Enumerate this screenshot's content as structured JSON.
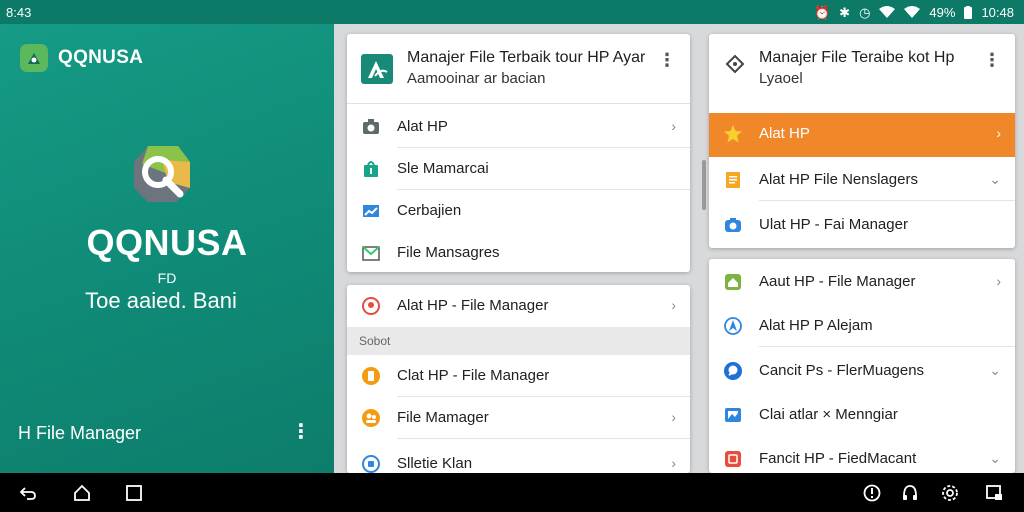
{
  "status_bar": {
    "left_text": "8:43",
    "right_text": "49%",
    "time": "10:48",
    "icons": [
      "alarm-icon",
      "bluetooth-icon",
      "clock-icon",
      "wifi-icon",
      "signal-icon",
      "battery-icon"
    ]
  },
  "hero": {
    "brand_name": "QQNUSA",
    "title": "QQNUSA",
    "small_text": "FD",
    "subtitle": "Toe aaied. Bani",
    "footer_label": "H File Manager",
    "more_icon": "more-vert-icon",
    "background_color": "#159b86"
  },
  "card_a": {
    "title": "Manajer File Terbaik tour HP Ayar",
    "subtitle": "Aamooinar ar bacian",
    "items": [
      {
        "label": "Alat HP",
        "icon": "camera-icon",
        "chevron": "›"
      },
      {
        "label": "Sle Mamarcai",
        "icon": "shopping-bag-icon",
        "chevron": ""
      },
      {
        "label": "Cerbajien",
        "icon": "chart-icon",
        "chevron": ""
      },
      {
        "label": "File Mansagres",
        "icon": "mail-icon",
        "chevron": ""
      }
    ]
  },
  "card_b": {
    "top_item": {
      "label": "Alat HP - File Manager",
      "icon": "location-pin-icon",
      "chevron": "›"
    },
    "section_label": "Sobot",
    "items": [
      {
        "label": "Clat HP - File Manager",
        "icon": "file-orange-icon",
        "chevron": ""
      },
      {
        "label": "File Mamager",
        "icon": "users-icon",
        "chevron": "›"
      },
      {
        "label": "Slletie Klan",
        "icon": "record-icon",
        "chevron": "›"
      }
    ]
  },
  "card_c": {
    "title": "Manajer File Teraibe kot Hp",
    "subtitle": "Lyaoel",
    "items": [
      {
        "label": "Alat HP",
        "icon": "star-icon",
        "chevron": "›",
        "active": true
      },
      {
        "label": "Alat HP File Nenslagers",
        "icon": "document-icon",
        "chevron": "⌄"
      },
      {
        "label": "Ulat HP - Fai Manager",
        "icon": "camera-blue-icon",
        "chevron": ""
      }
    ],
    "accent_color": "#f0882a"
  },
  "card_d": {
    "items": [
      {
        "label": "Aaut HP  -  File Manager",
        "icon": "home-green-icon",
        "chevron": "›"
      },
      {
        "label": "Alat HP P Alejam",
        "icon": "navigation-icon",
        "chevron": ""
      },
      {
        "label": "Cancit Ps - FlerMuagens",
        "icon": "chat-icon",
        "chevron": "⌄"
      },
      {
        "label": "Clai atlar × Menngiar",
        "icon": "image-icon",
        "chevron": ""
      },
      {
        "label": "Fancit HP - FiedMacant",
        "icon": "file-red-icon",
        "chevron": "⌄"
      }
    ]
  },
  "nav_bar": {
    "buttons": [
      "back-icon",
      "home-icon",
      "recents-icon",
      "alert-icon",
      "headset-icon",
      "settings-icon",
      "screen-icon"
    ]
  }
}
